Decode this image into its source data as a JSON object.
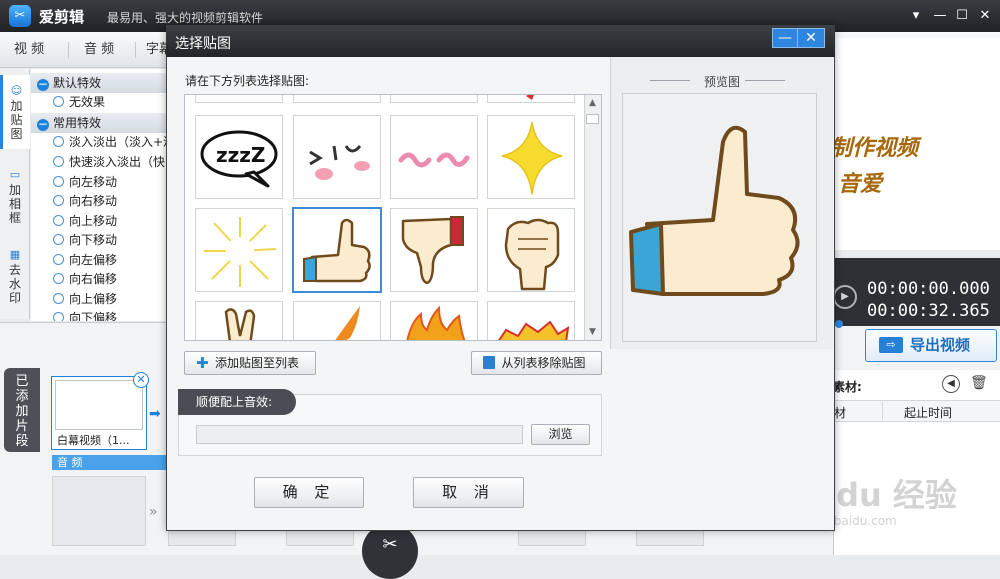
{
  "app": {
    "name": "爱剪辑",
    "slogan": "最易用、强大的视频剪辑软件"
  },
  "main_tabs": [
    "视 频",
    "音 频",
    "字幕"
  ],
  "left_vtabs": [
    {
      "label": "加\n贴\n图",
      "icon": "sticker-icon"
    },
    {
      "label": "加\n相\n框",
      "icon": "frame-icon"
    },
    {
      "label": "去\n水\n印",
      "icon": "mosaic-icon"
    }
  ],
  "effects": {
    "group_default": "默认特效",
    "default_items": [
      "无效果"
    ],
    "group_common": "常用特效",
    "common_items": [
      "淡入淡出（淡入+淡",
      "快速淡入淡出（快",
      "向左移动",
      "向右移动",
      "向上移动",
      "向下移动",
      "向左偏移",
      "向右偏移",
      "向上偏移",
      "向下偏移"
    ]
  },
  "timeline": {
    "added_label": "已\n添\n加\n片\n段",
    "clip_name": "白幕视频（1...",
    "audio_strip": "音 频"
  },
  "preview": {
    "overlay_line1": "制作视频",
    "overlay_line2": "音爱",
    "time_current": "00:00:00.000",
    "time_total": "00:00:32.365"
  },
  "export_button": "导出视频",
  "material": {
    "title": "素材:",
    "col1": "材",
    "col2": "起止时间"
  },
  "dialog": {
    "title": "选择贴图",
    "instruction": "请在下方列表选择贴图:",
    "preview_label": "预览图",
    "add_button": "添加贴图至列表",
    "remove_button": "从列表移除贴图",
    "audio_label": "顺便配上音效:",
    "browse_button": "浏览",
    "ok_button": "确 定",
    "cancel_button": "取 消",
    "zzz_text": "zzzZ"
  },
  "stickers": [
    {
      "name": "sticker-zzz",
      "selected": false
    },
    {
      "name": "sticker-blush-face",
      "selected": false
    },
    {
      "name": "sticker-pink-swirl",
      "selected": false
    },
    {
      "name": "sticker-yellow-star",
      "selected": false
    },
    {
      "name": "sticker-sunburst",
      "selected": false
    },
    {
      "name": "sticker-thumbs-up",
      "selected": true
    },
    {
      "name": "sticker-thumbs-down",
      "selected": false
    },
    {
      "name": "sticker-fist",
      "selected": false
    }
  ],
  "watermark": {
    "text": "Bai du 经验",
    "url": "jingyan.baidu.com"
  },
  "colors": {
    "accent": "#2f86df",
    "dark_bar": "#2d3034",
    "preview_text": "#a7680a"
  }
}
